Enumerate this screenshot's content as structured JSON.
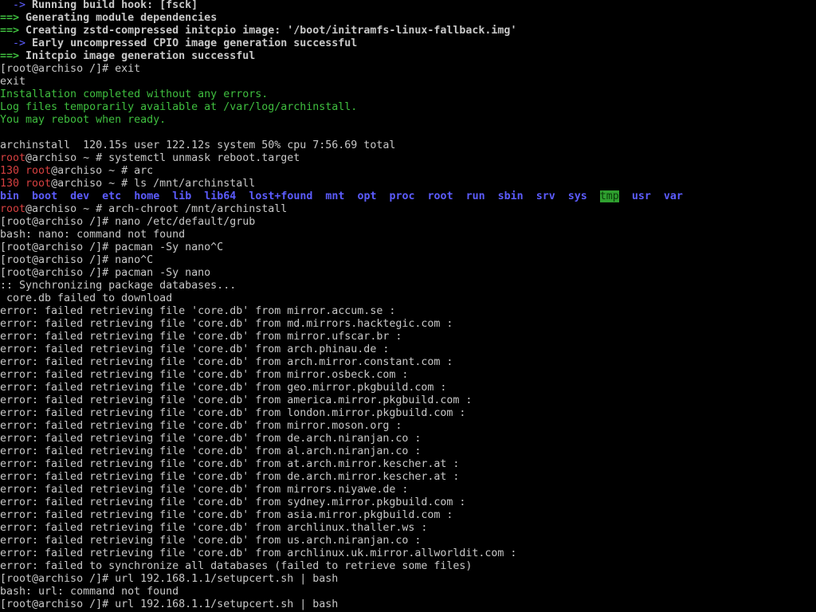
{
  "terminal": {
    "lines": [
      [
        {
          "t": "  -> ",
          "c": "blue"
        },
        {
          "t": "Running build hook: [fsck]",
          "c": "default",
          "b": true
        }
      ],
      [
        {
          "t": "==> ",
          "c": "green",
          "b": true
        },
        {
          "t": "Generating module dependencies",
          "c": "default",
          "b": true
        }
      ],
      [
        {
          "t": "==> ",
          "c": "green",
          "b": true
        },
        {
          "t": "Creating zstd-compressed initcpio image: '/boot/initramfs-linux-fallback.img'",
          "c": "default",
          "b": true
        }
      ],
      [
        {
          "t": "  -> ",
          "c": "blue"
        },
        {
          "t": "Early uncompressed CPIO image generation successful",
          "c": "default",
          "b": true
        }
      ],
      [
        {
          "t": "==> ",
          "c": "green",
          "b": true
        },
        {
          "t": "Initcpio image generation successful",
          "c": "default",
          "b": true
        }
      ],
      [
        {
          "t": "[root@archiso /]# exit",
          "c": "default"
        }
      ],
      [
        {
          "t": "exit",
          "c": "default"
        }
      ],
      [
        {
          "t": "Installation completed without any errors.",
          "c": "green"
        }
      ],
      [
        {
          "t": "Log files temporarily available at /var/log/archinstall.",
          "c": "green"
        }
      ],
      [
        {
          "t": "You may reboot when ready.",
          "c": "green"
        }
      ],
      [
        {
          "t": "",
          "c": "default"
        }
      ],
      [
        {
          "t": "archinstall  120.15s user 122.12s system 50% cpu 7:56.69 total",
          "c": "default"
        }
      ],
      [
        {
          "t": "root",
          "c": "red"
        },
        {
          "t": "@archiso ~ # systemctl unmask reboot.target",
          "c": "default"
        }
      ],
      [
        {
          "t": "130 ",
          "c": "red"
        },
        {
          "t": "root",
          "c": "red"
        },
        {
          "t": "@archiso ~ # arc",
          "c": "default"
        }
      ],
      [
        {
          "t": "130 ",
          "c": "red"
        },
        {
          "t": "root",
          "c": "red"
        },
        {
          "t": "@archiso ~ # ls /mnt/archinstall",
          "c": "default"
        }
      ],
      [
        {
          "t": "bin",
          "c": "blue",
          "b": true
        },
        {
          "t": "  ",
          "c": "default"
        },
        {
          "t": "boot",
          "c": "blue",
          "b": true
        },
        {
          "t": "  ",
          "c": "default"
        },
        {
          "t": "dev",
          "c": "blue",
          "b": true
        },
        {
          "t": "  ",
          "c": "default"
        },
        {
          "t": "etc",
          "c": "blue",
          "b": true
        },
        {
          "t": "  ",
          "c": "default"
        },
        {
          "t": "home",
          "c": "blue",
          "b": true
        },
        {
          "t": "  ",
          "c": "default"
        },
        {
          "t": "lib",
          "c": "blue",
          "b": true
        },
        {
          "t": "  ",
          "c": "default"
        },
        {
          "t": "lib64",
          "c": "blue",
          "b": true
        },
        {
          "t": "  ",
          "c": "default"
        },
        {
          "t": "lost+found",
          "c": "blue",
          "b": true
        },
        {
          "t": "  ",
          "c": "default"
        },
        {
          "t": "mnt",
          "c": "blue",
          "b": true
        },
        {
          "t": "  ",
          "c": "default"
        },
        {
          "t": "opt",
          "c": "blue",
          "b": true
        },
        {
          "t": "  ",
          "c": "default"
        },
        {
          "t": "proc",
          "c": "blue",
          "b": true
        },
        {
          "t": "  ",
          "c": "default"
        },
        {
          "t": "root",
          "c": "blue",
          "b": true
        },
        {
          "t": "  ",
          "c": "default"
        },
        {
          "t": "run",
          "c": "blue",
          "b": true
        },
        {
          "t": "  ",
          "c": "default"
        },
        {
          "t": "sbin",
          "c": "blue",
          "b": true
        },
        {
          "t": "  ",
          "c": "default"
        },
        {
          "t": "srv",
          "c": "blue",
          "b": true
        },
        {
          "t": "  ",
          "c": "default"
        },
        {
          "t": "sys",
          "c": "blue",
          "b": true
        },
        {
          "t": "  ",
          "c": "default"
        },
        {
          "t": "tmp",
          "c": "highlight"
        },
        {
          "t": "  ",
          "c": "default"
        },
        {
          "t": "usr",
          "c": "blue",
          "b": true
        },
        {
          "t": "  ",
          "c": "default"
        },
        {
          "t": "var",
          "c": "blue",
          "b": true
        }
      ],
      [
        {
          "t": "root",
          "c": "red"
        },
        {
          "t": "@archiso ~ # arch-chroot /mnt/archinstall",
          "c": "default"
        }
      ],
      [
        {
          "t": "[root@archiso /]# nano /etc/default/grub",
          "c": "default"
        }
      ],
      [
        {
          "t": "bash: nano: command not found",
          "c": "default"
        }
      ],
      [
        {
          "t": "[root@archiso /]# pacman -Sy nano^C",
          "c": "default"
        }
      ],
      [
        {
          "t": "[root@archiso /]# nano^C",
          "c": "default"
        }
      ],
      [
        {
          "t": "[root@archiso /]# pacman -Sy nano",
          "c": "default"
        }
      ],
      [
        {
          "t": ":: Synchronizing package databases...",
          "c": "default"
        }
      ],
      [
        {
          "t": " core.db failed to download",
          "c": "default"
        }
      ],
      [
        {
          "t": "error: failed retrieving file 'core.db' from mirror.accum.se :",
          "c": "default"
        }
      ],
      [
        {
          "t": "error: failed retrieving file 'core.db' from md.mirrors.hacktegic.com :",
          "c": "default"
        }
      ],
      [
        {
          "t": "error: failed retrieving file 'core.db' from mirror.ufscar.br :",
          "c": "default"
        }
      ],
      [
        {
          "t": "error: failed retrieving file 'core.db' from arch.phinau.de :",
          "c": "default"
        }
      ],
      [
        {
          "t": "error: failed retrieving file 'core.db' from arch.mirror.constant.com :",
          "c": "default"
        }
      ],
      [
        {
          "t": "error: failed retrieving file 'core.db' from mirror.osbeck.com :",
          "c": "default"
        }
      ],
      [
        {
          "t": "error: failed retrieving file 'core.db' from geo.mirror.pkgbuild.com :",
          "c": "default"
        }
      ],
      [
        {
          "t": "error: failed retrieving file 'core.db' from america.mirror.pkgbuild.com :",
          "c": "default"
        }
      ],
      [
        {
          "t": "error: failed retrieving file 'core.db' from london.mirror.pkgbuild.com :",
          "c": "default"
        }
      ],
      [
        {
          "t": "error: failed retrieving file 'core.db' from mirror.moson.org :",
          "c": "default"
        }
      ],
      [
        {
          "t": "error: failed retrieving file 'core.db' from de.arch.niranjan.co :",
          "c": "default"
        }
      ],
      [
        {
          "t": "error: failed retrieving file 'core.db' from al.arch.niranjan.co :",
          "c": "default"
        }
      ],
      [
        {
          "t": "error: failed retrieving file 'core.db' from at.arch.mirror.kescher.at :",
          "c": "default"
        }
      ],
      [
        {
          "t": "error: failed retrieving file 'core.db' from de.arch.mirror.kescher.at :",
          "c": "default"
        }
      ],
      [
        {
          "t": "error: failed retrieving file 'core.db' from mirrors.niyawe.de :",
          "c": "default"
        }
      ],
      [
        {
          "t": "error: failed retrieving file 'core.db' from sydney.mirror.pkgbuild.com :",
          "c": "default"
        }
      ],
      [
        {
          "t": "error: failed retrieving file 'core.db' from asia.mirror.pkgbuild.com :",
          "c": "default"
        }
      ],
      [
        {
          "t": "error: failed retrieving file 'core.db' from archlinux.thaller.ws :",
          "c": "default"
        }
      ],
      [
        {
          "t": "error: failed retrieving file 'core.db' from us.arch.niranjan.co :",
          "c": "default"
        }
      ],
      [
        {
          "t": "error: failed retrieving file 'core.db' from archlinux.uk.mirror.allworldit.com :",
          "c": "default"
        }
      ],
      [
        {
          "t": "error: failed to synchronize all databases (failed to retrieve some files)",
          "c": "default"
        }
      ],
      [
        {
          "t": "[root@archiso /]# url 192.168.1.1/setupcert.sh | bash",
          "c": "default"
        }
      ],
      [
        {
          "t": "bash: url: command not found",
          "c": "default"
        }
      ],
      [
        {
          "t": "[root@archiso /]# url 192.168.1.1/setupcert.sh | bash",
          "c": "default"
        }
      ]
    ],
    "colors": {
      "background": "#000000",
      "default": "#c8c8c8",
      "green": "#3fbf3f",
      "blue": "#5c5cff",
      "red": "#d64040",
      "highlight_bg": "#2fa02f"
    }
  }
}
